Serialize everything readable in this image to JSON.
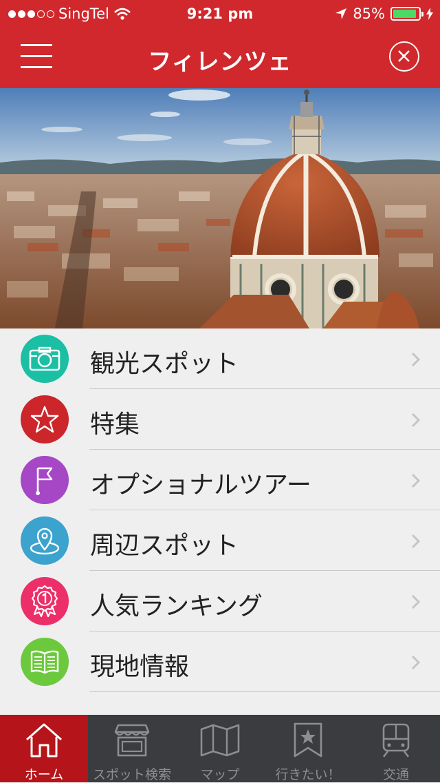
{
  "status_bar": {
    "carrier": "SingTel",
    "time": "9:21 pm",
    "battery_percent": "85%",
    "signal_bars_filled": 3,
    "signal_bars_total": 5,
    "battery_level": 0.85
  },
  "header": {
    "title": "フィレンツェ",
    "background": "#d0282c"
  },
  "menu": {
    "items": [
      {
        "label": "観光スポット",
        "icon": "camera-icon",
        "color": "#1bbfa3"
      },
      {
        "label": "特集",
        "icon": "star-icon",
        "color": "#cc262b"
      },
      {
        "label": "オプショナルツアー",
        "icon": "flag-icon",
        "color": "#a647c6"
      },
      {
        "label": "周辺スポット",
        "icon": "location-pin-icon",
        "color": "#3ba3cd"
      },
      {
        "label": "人気ランキング",
        "icon": "ranking-medal-icon",
        "color": "#ec2e69"
      },
      {
        "label": "現地情報",
        "icon": "book-icon",
        "color": "#6cc93d"
      }
    ]
  },
  "tab_bar": {
    "tabs": [
      {
        "label": "ホーム",
        "icon": "home-icon",
        "active": true
      },
      {
        "label": "スポット検索",
        "icon": "shop-icon",
        "active": false
      },
      {
        "label": "マップ",
        "icon": "map-icon",
        "active": false
      },
      {
        "label": "行きたい！",
        "icon": "bookmark-star-icon",
        "active": false
      },
      {
        "label": "交通",
        "icon": "train-icon",
        "active": false
      }
    ]
  }
}
